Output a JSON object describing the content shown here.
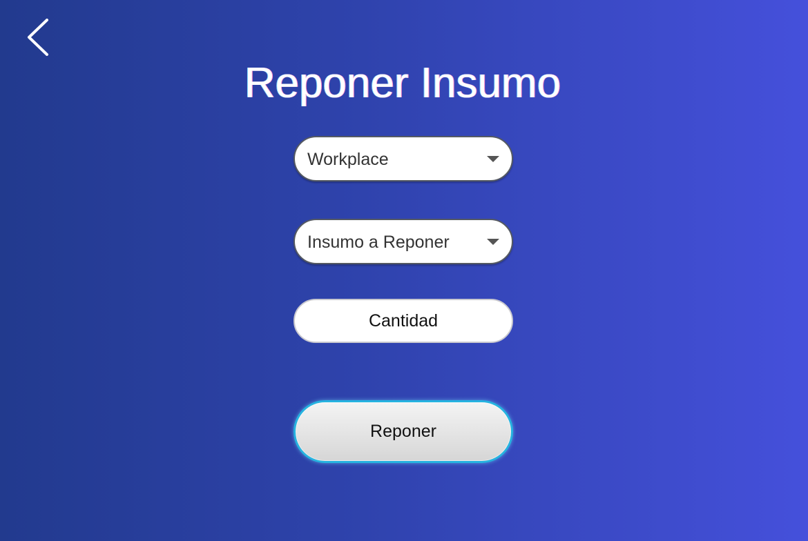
{
  "header": {
    "back_icon": "chevron-left-icon",
    "title": "Reponer Insumo"
  },
  "form": {
    "workplace_select": {
      "selected": "Workplace",
      "icon": "caret-down-icon"
    },
    "insumo_select": {
      "selected": "Insumo a Reponer",
      "icon": "caret-down-icon"
    },
    "cantidad_input": {
      "placeholder": "Cantidad"
    },
    "submit_label": "Reponer"
  },
  "colors": {
    "background_start": "#223a8e",
    "background_end": "#4550db",
    "button_border": "#26b3e0"
  }
}
